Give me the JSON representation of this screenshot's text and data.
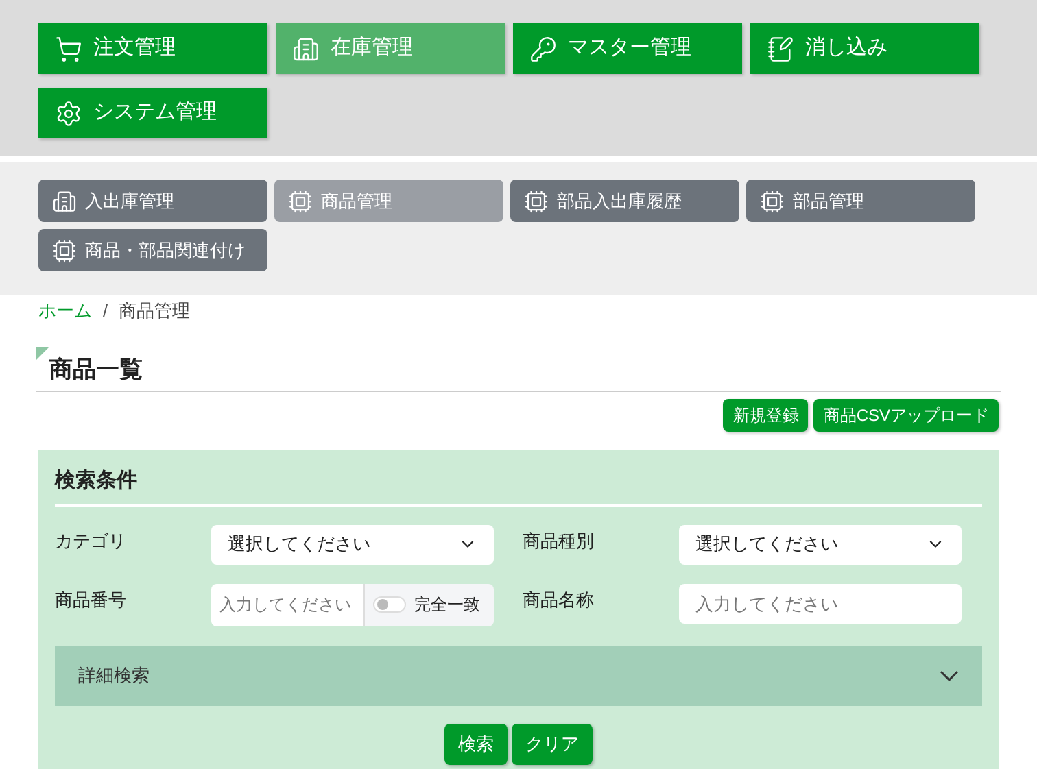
{
  "main_nav": [
    {
      "label": "注文管理",
      "selected": false
    },
    {
      "label": "在庫管理",
      "selected": true
    },
    {
      "label": "マスター管理",
      "selected": false
    },
    {
      "label": "消し込み",
      "selected": false
    },
    {
      "label": "システム管理",
      "selected": false
    }
  ],
  "sub_nav": [
    {
      "label": "入出庫管理",
      "selected": false
    },
    {
      "label": "商品管理",
      "selected": true
    },
    {
      "label": "部品入出庫履歴",
      "selected": false
    },
    {
      "label": "部品管理",
      "selected": false
    },
    {
      "label": "商品・部品関連付け",
      "selected": false
    }
  ],
  "breadcrumb": [
    {
      "label": "ホーム",
      "kind": "link"
    },
    {
      "label": "/",
      "kind": "separator"
    },
    {
      "label": "商品管理",
      "kind": "current"
    }
  ],
  "page_title": "商品一覧",
  "actions": [
    "新規登録",
    "商品CSVアップロード"
  ],
  "search_panel": {
    "title": "検索条件",
    "fields": [
      {
        "label": "カテゴリ",
        "kind": "select",
        "placeholder": "選択してください"
      },
      {
        "label": "商品種別",
        "kind": "select",
        "placeholder": "選択してください"
      },
      {
        "label": "商品番号",
        "kind": "text_toggle",
        "placeholder": "入力してください",
        "toggle": {
          "label": "完全一致",
          "on": false
        }
      },
      {
        "label": "商品名称",
        "kind": "text",
        "placeholder": "入力してください"
      }
    ],
    "advanced": {
      "label": "詳細検索",
      "expanded": false
    },
    "buttons": [
      "検索",
      "クリア"
    ]
  }
}
